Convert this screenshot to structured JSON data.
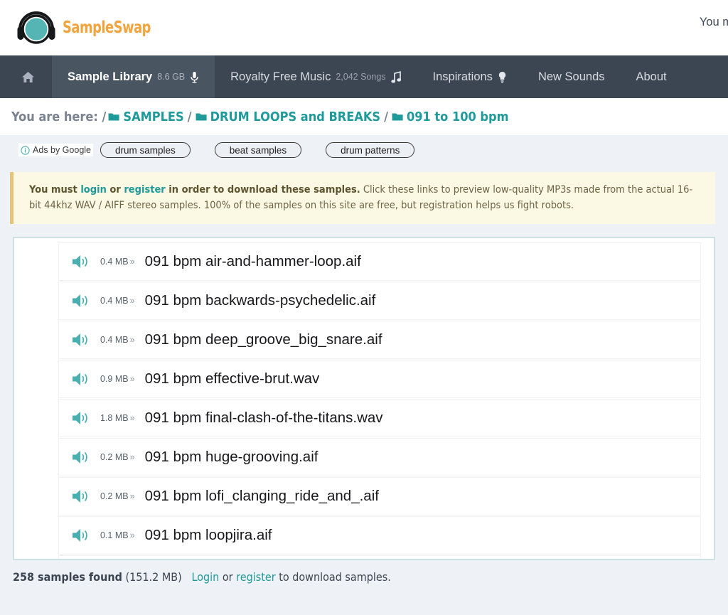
{
  "header": {
    "logo_text": "SampleSwap",
    "logo_icon": "headphones-icon",
    "right_text": "You must"
  },
  "nav": {
    "items": [
      {
        "label": "",
        "sub": "",
        "icon": "home-icon",
        "active": false,
        "name": "home"
      },
      {
        "label": "Sample Library",
        "sub": "8.6 GB",
        "icon": "microphone-icon",
        "active": true,
        "name": "sample-library"
      },
      {
        "label": "Royalty Free Music",
        "sub": "2,042 Songs",
        "icon": "music-note-icon",
        "active": false,
        "name": "royalty-free-music"
      },
      {
        "label": "Inspirations",
        "sub": "",
        "icon": "lightbulb-icon",
        "active": false,
        "name": "inspirations"
      },
      {
        "label": "New Sounds",
        "sub": "",
        "icon": "",
        "active": false,
        "name": "new-sounds"
      },
      {
        "label": "About",
        "sub": "",
        "icon": "",
        "active": false,
        "name": "about"
      }
    ]
  },
  "breadcrumb": {
    "prefix": "You are here: /",
    "separator": "/",
    "items": [
      {
        "label": "SAMPLES",
        "icon": "folder-icon"
      },
      {
        "label": "DRUM LOOPS and BREAKS",
        "icon": "folder-icon"
      },
      {
        "label": "091 to 100 bpm",
        "icon": "folder-icon"
      }
    ]
  },
  "ads": {
    "label": "Ads by Google",
    "info_icon": "info-icon",
    "pills": [
      "drum samples",
      "beat samples",
      "drum patterns"
    ]
  },
  "notice": {
    "bold_prefix": "You must ",
    "login_link": "login",
    "or_text": " or ",
    "register_link": "register",
    "bold_suffix": " in order to download these samples.",
    "body": " Click these links to preview low-quality MP3s made from the actual 16-bit 44khz WAV / AIFF stereo samples. 100% of the samples on this site are free, but registration helps us fight robots."
  },
  "samples": {
    "icon": "speaker-icon",
    "arrows": "»",
    "rows": [
      {
        "size": "0.4 MB",
        "name": "091 bpm air-and-hammer-loop.aif"
      },
      {
        "size": "0.4 MB",
        "name": "091 bpm backwards-psychedelic.aif"
      },
      {
        "size": "0.4 MB",
        "name": "091 bpm deep_groove_big_snare.aif"
      },
      {
        "size": "0.9 MB",
        "name": "091 bpm effective-brut.wav"
      },
      {
        "size": "1.8 MB",
        "name": "091 bpm final-clash-of-the-titans.wav"
      },
      {
        "size": "0.2 MB",
        "name": "091 bpm huge-grooving.aif"
      },
      {
        "size": "0.2 MB",
        "name": "091 bpm lofi_clanging_ride_and_.aif"
      },
      {
        "size": "0.1 MB",
        "name": "091 bpm loopjira.aif"
      }
    ]
  },
  "footer": {
    "count": "258 samples found",
    "total_size": "(151.2 MB)",
    "login_link": "Login",
    "or_text": "or",
    "register_link": "register",
    "suffix": "to download samples."
  },
  "colors": {
    "teal": "#1f9a9a",
    "speaker_teal": "#4aafb0",
    "orange": "#f2a33c",
    "nav_bg": "#3c4552",
    "nav_active": "#4a5562",
    "notice_bg": "#fbf8e3",
    "notice_border": "#e6c478",
    "page_bg": "#eef1f5"
  }
}
